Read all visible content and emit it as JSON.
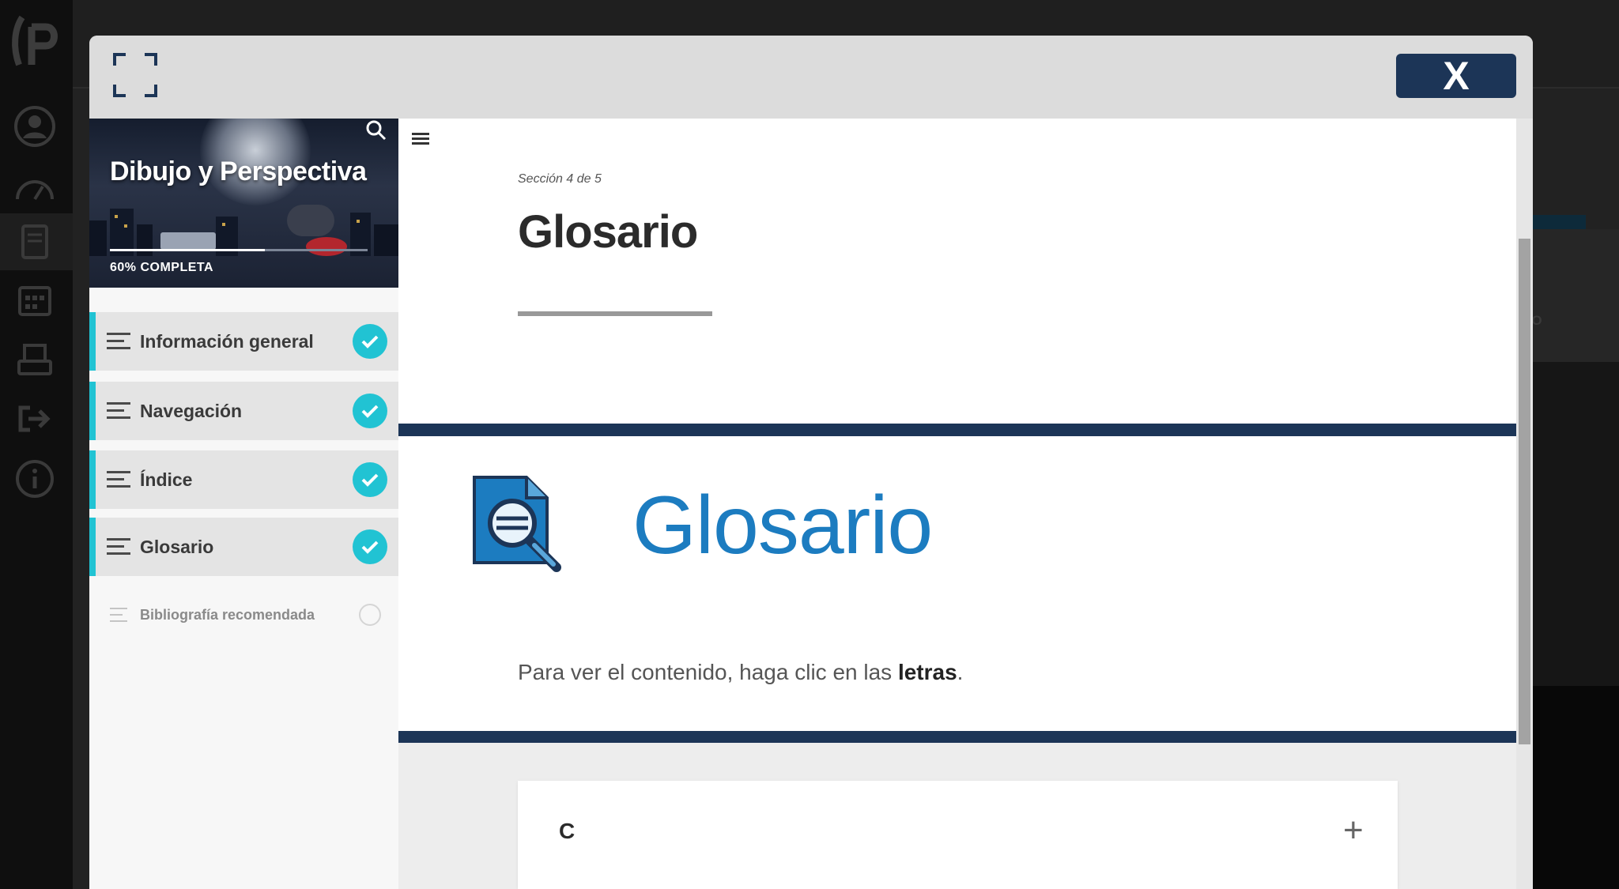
{
  "modal": {
    "close_label": "X"
  },
  "course": {
    "title": "Dibujo y Perspectiva",
    "progress_percent": 60,
    "progress_label": "60% COMPLETA"
  },
  "lessons": [
    {
      "label": "Información general",
      "status": "complete"
    },
    {
      "label": "Navegación",
      "status": "complete"
    },
    {
      "label": "Índice",
      "status": "complete"
    },
    {
      "label": "Glosario",
      "status": "complete"
    },
    {
      "label": "Bibliografía recomendada",
      "status": "pending"
    }
  ],
  "page": {
    "section_count": "Sección 4 de 5",
    "title": "Glosario",
    "banner_heading": "Glosario",
    "instruction_prefix": "Para ver el contenido, haga clic en las ",
    "instruction_bold": "letras",
    "instruction_suffix": "."
  },
  "accordion": {
    "letter": "C",
    "toggle": "+"
  },
  "background": {
    "partial_label": "EO"
  },
  "colors": {
    "accent": "#21c3d3",
    "navy": "#1c3557",
    "heading_blue": "#1c7cc0"
  }
}
